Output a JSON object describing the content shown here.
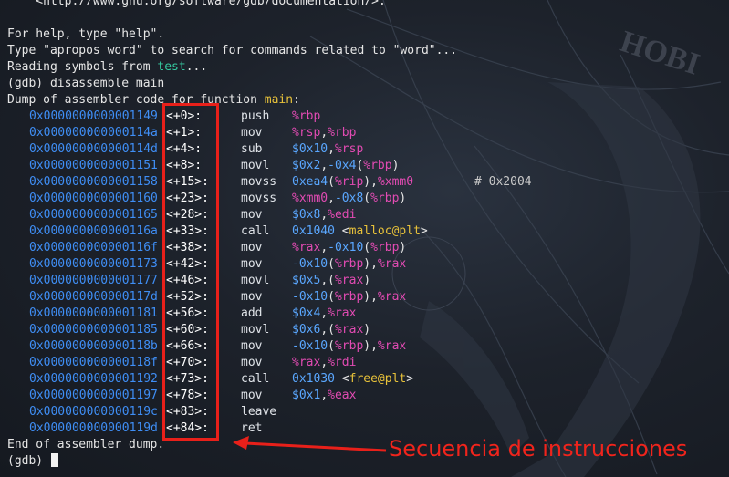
{
  "terminal": {
    "doc_url_line": "    <http://www.gnu.org/software/gdb/documentation/>.",
    "help_line": "For help, type \"help\".",
    "apropos_line": "Type \"apropos word\" to search for commands related to \"word\"...",
    "reading_prefix": "Reading symbols from ",
    "reading_file": "test",
    "reading_suffix": "...",
    "command_line": "(gdb) disassemble main",
    "dump_prefix": "Dump of assembler code for function ",
    "dump_function": "main",
    "dump_suffix": ":",
    "end_line": "End of assembler dump.",
    "prompt": "(gdb) "
  },
  "instructions": [
    {
      "addr": "0x0000000000001149",
      "offset": "<+0>:",
      "mnemonic": "push",
      "operands": [
        [
          "reg",
          "%rbp"
        ]
      ]
    },
    {
      "addr": "0x000000000000114a",
      "offset": "<+1>:",
      "mnemonic": "mov",
      "operands": [
        [
          "reg",
          "%rsp"
        ],
        [
          "sym",
          ","
        ],
        [
          "reg",
          "%rbp"
        ]
      ]
    },
    {
      "addr": "0x000000000000114d",
      "offset": "<+4>:",
      "mnemonic": "sub",
      "operands": [
        [
          "imm",
          "$0x10"
        ],
        [
          "sym",
          ","
        ],
        [
          "reg",
          "%rsp"
        ]
      ]
    },
    {
      "addr": "0x0000000000001151",
      "offset": "<+8>:",
      "mnemonic": "movl",
      "operands": [
        [
          "imm",
          "$0x2"
        ],
        [
          "sym",
          ","
        ],
        [
          "imm",
          "-0x4"
        ],
        [
          "sym",
          "("
        ],
        [
          "reg",
          "%rbp"
        ],
        [
          "sym",
          ")"
        ]
      ]
    },
    {
      "addr": "0x0000000000001158",
      "offset": "<+15>:",
      "mnemonic": "movss",
      "operands": [
        [
          "imm",
          "0xea4"
        ],
        [
          "sym",
          "("
        ],
        [
          "reg",
          "%rip"
        ],
        [
          "sym",
          "),"
        ],
        [
          "reg",
          "%xmm0"
        ]
      ],
      "comment": "# 0x2004"
    },
    {
      "addr": "0x0000000000001160",
      "offset": "<+23>:",
      "mnemonic": "movss",
      "operands": [
        [
          "reg",
          "%xmm0"
        ],
        [
          "sym",
          ","
        ],
        [
          "imm",
          "-0x8"
        ],
        [
          "sym",
          "("
        ],
        [
          "reg",
          "%rbp"
        ],
        [
          "sym",
          ")"
        ]
      ]
    },
    {
      "addr": "0x0000000000001165",
      "offset": "<+28>:",
      "mnemonic": "mov",
      "operands": [
        [
          "imm",
          "$0x8"
        ],
        [
          "sym",
          ","
        ],
        [
          "reg",
          "%edi"
        ]
      ]
    },
    {
      "addr": "0x000000000000116a",
      "offset": "<+33>:",
      "mnemonic": "call",
      "operands": [
        [
          "imm",
          "0x1040"
        ],
        [
          "sym",
          " <"
        ],
        [
          "fn",
          "malloc@plt"
        ],
        [
          "sym",
          ">"
        ]
      ]
    },
    {
      "addr": "0x000000000000116f",
      "offset": "<+38>:",
      "mnemonic": "mov",
      "operands": [
        [
          "reg",
          "%rax"
        ],
        [
          "sym",
          ","
        ],
        [
          "imm",
          "-0x10"
        ],
        [
          "sym",
          "("
        ],
        [
          "reg",
          "%rbp"
        ],
        [
          "sym",
          ")"
        ]
      ]
    },
    {
      "addr": "0x0000000000001173",
      "offset": "<+42>:",
      "mnemonic": "mov",
      "operands": [
        [
          "imm",
          "-0x10"
        ],
        [
          "sym",
          "("
        ],
        [
          "reg",
          "%rbp"
        ],
        [
          "sym",
          "),"
        ],
        [
          "reg",
          "%rax"
        ]
      ]
    },
    {
      "addr": "0x0000000000001177",
      "offset": "<+46>:",
      "mnemonic": "movl",
      "operands": [
        [
          "imm",
          "$0x5"
        ],
        [
          "sym",
          ",("
        ],
        [
          "reg",
          "%rax"
        ],
        [
          "sym",
          ")"
        ]
      ]
    },
    {
      "addr": "0x000000000000117d",
      "offset": "<+52>:",
      "mnemonic": "mov",
      "operands": [
        [
          "imm",
          "-0x10"
        ],
        [
          "sym",
          "("
        ],
        [
          "reg",
          "%rbp"
        ],
        [
          "sym",
          "),"
        ],
        [
          "reg",
          "%rax"
        ]
      ]
    },
    {
      "addr": "0x0000000000001181",
      "offset": "<+56>:",
      "mnemonic": "add",
      "operands": [
        [
          "imm",
          "$0x4"
        ],
        [
          "sym",
          ","
        ],
        [
          "reg",
          "%rax"
        ]
      ]
    },
    {
      "addr": "0x0000000000001185",
      "offset": "<+60>:",
      "mnemonic": "movl",
      "operands": [
        [
          "imm",
          "$0x6"
        ],
        [
          "sym",
          ",("
        ],
        [
          "reg",
          "%rax"
        ],
        [
          "sym",
          ")"
        ]
      ]
    },
    {
      "addr": "0x000000000000118b",
      "offset": "<+66>:",
      "mnemonic": "mov",
      "operands": [
        [
          "imm",
          "-0x10"
        ],
        [
          "sym",
          "("
        ],
        [
          "reg",
          "%rbp"
        ],
        [
          "sym",
          "),"
        ],
        [
          "reg",
          "%rax"
        ]
      ]
    },
    {
      "addr": "0x000000000000118f",
      "offset": "<+70>:",
      "mnemonic": "mov",
      "operands": [
        [
          "reg",
          "%rax"
        ],
        [
          "sym",
          ","
        ],
        [
          "reg",
          "%rdi"
        ]
      ]
    },
    {
      "addr": "0x0000000000001192",
      "offset": "<+73>:",
      "mnemonic": "call",
      "operands": [
        [
          "imm",
          "0x1030"
        ],
        [
          "sym",
          " <"
        ],
        [
          "fn",
          "free@plt"
        ],
        [
          "sym",
          ">"
        ]
      ]
    },
    {
      "addr": "0x0000000000001197",
      "offset": "<+78>:",
      "mnemonic": "mov",
      "operands": [
        [
          "imm",
          "$0x1"
        ],
        [
          "sym",
          ","
        ],
        [
          "reg",
          "%eax"
        ]
      ]
    },
    {
      "addr": "0x000000000000119c",
      "offset": "<+83>:",
      "mnemonic": "leave",
      "operands": []
    },
    {
      "addr": "0x000000000000119d",
      "offset": "<+84>:",
      "mnemonic": "ret",
      "operands": []
    }
  ],
  "annotation": {
    "label": "Secuencia de instrucciones",
    "color": "#f0241c"
  },
  "background_text": "HOBI",
  "colors": {
    "address": "#3f8ef5",
    "register": "#e24bb3",
    "immediate": "#5aa7ff",
    "filename": "#35c9a0",
    "function": "#e8c23a"
  }
}
